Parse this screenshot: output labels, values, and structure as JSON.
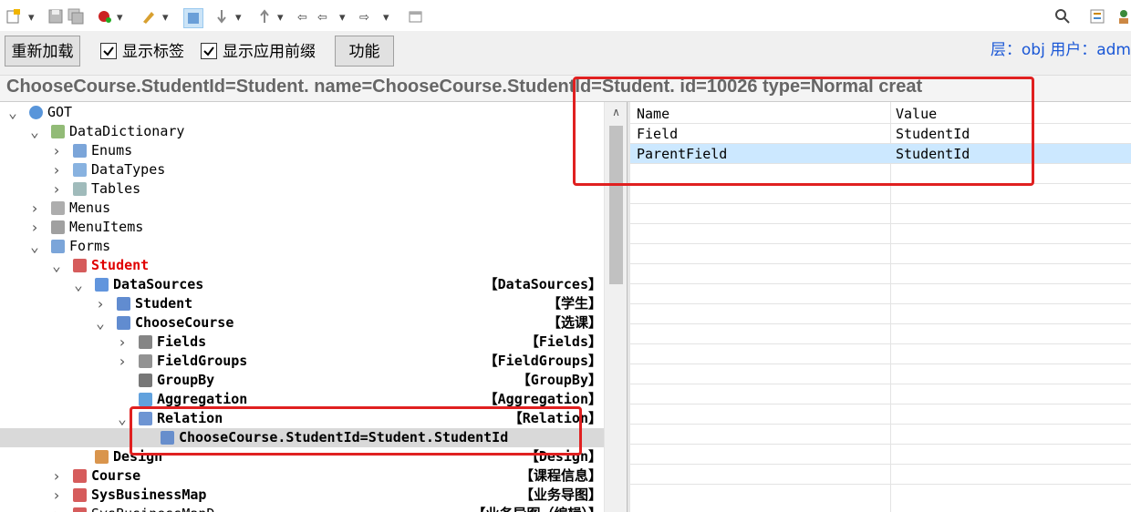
{
  "toolbar": {
    "icons": [
      "new-icon",
      "dropdown-arrow",
      "save-icon",
      "save-all-icon",
      "dropdown-arrow",
      "compile-icon",
      "dropdown-arrow",
      "brush-icon",
      "dropdown-arrow",
      "select-icon",
      "down-icon",
      "dropdown-arrow",
      "up-icon",
      "dropdown-arrow",
      "back-icon",
      "dropdown-arrow",
      "forward-icon",
      "dropdown-arrow",
      "window-icon"
    ],
    "right_icons": [
      "search-icon",
      "properties-icon",
      "user-icon"
    ]
  },
  "buttons": {
    "reload": "重新加载",
    "show_labels": "显示标签",
    "show_prefix": "显示应用前缀",
    "features": "功能"
  },
  "user_info": "层：obj 用户：adm",
  "caption": "ChooseCourse.StudentId=Student. name=ChooseCourse.StudentId=Student. id=10026 type=Normal creat",
  "tree": [
    {
      "label": "GOT",
      "tag": "",
      "icon": "globe-icon",
      "chev": "v"
    },
    {
      "label": "DataDictionary",
      "tag": "",
      "icon": "data-dictionary-icon",
      "chev": "v"
    },
    {
      "label": "Enums",
      "tag": "",
      "icon": "enum-icon",
      "chev": ">"
    },
    {
      "label": "DataTypes",
      "tag": "",
      "icon": "datatype-icon",
      "chev": ">"
    },
    {
      "label": "Tables",
      "tag": "",
      "icon": "table-icon",
      "chev": ">"
    },
    {
      "label": "Menus",
      "tag": "",
      "icon": "menu-icon",
      "chev": ">"
    },
    {
      "label": "MenuItems",
      "tag": "",
      "icon": "menuitem-icon",
      "chev": ">"
    },
    {
      "label": "Forms",
      "tag": "",
      "icon": "forms-icon",
      "chev": "v"
    },
    {
      "label": "Student",
      "tag": "",
      "icon": "form-icon",
      "chev": "v"
    },
    {
      "label": "DataSources",
      "tag": "【DataSources】",
      "icon": "datasources-icon",
      "chev": "v"
    },
    {
      "label": "Student",
      "tag": "【学生】",
      "icon": "datasource-icon",
      "chev": ">"
    },
    {
      "label": "ChooseCourse",
      "tag": "【选课】",
      "icon": "datasource-icon",
      "chev": "v"
    },
    {
      "label": "Fields",
      "tag": "【Fields】",
      "icon": "fields-icon",
      "chev": ">"
    },
    {
      "label": "FieldGroups",
      "tag": "【FieldGroups】",
      "icon": "fieldgroups-icon",
      "chev": ">"
    },
    {
      "label": "GroupBy",
      "tag": "【GroupBy】",
      "icon": "groupby-icon",
      "chev": ""
    },
    {
      "label": "Aggregation",
      "tag": "【Aggregation】",
      "icon": "aggregation-icon",
      "chev": ""
    },
    {
      "label": "Relation",
      "tag": "【Relation】",
      "icon": "relation-icon",
      "chev": "v"
    },
    {
      "label": "ChooseCourse.StudentId=Student.StudentId",
      "tag": "",
      "icon": "relation-item-icon",
      "chev": ""
    },
    {
      "label": "Design",
      "tag": "【Design】",
      "icon": "design-icon",
      "chev": ""
    },
    {
      "label": "Course",
      "tag": "【课程信息】",
      "icon": "form-icon",
      "chev": ">"
    },
    {
      "label": "SysBusinessMap",
      "tag": "【业务导图】",
      "icon": "form-icon",
      "chev": ">"
    },
    {
      "label": "SysBusinessMapD...",
      "tag": "【业务导图（编辑）】",
      "icon": "form-icon",
      "chev": ">"
    }
  ],
  "grid": {
    "headers": [
      "Name",
      "Value"
    ],
    "rows": [
      {
        "name": "Field",
        "value": "StudentId"
      },
      {
        "name": "ParentField",
        "value": "StudentId"
      }
    ]
  },
  "colors": {
    "highlight": "#e02020",
    "selected_grid_row": "#cce8ff",
    "selected_tree_row": "#d9d9d9",
    "user_info": "#1a57d6",
    "active_form": "#e00000"
  }
}
